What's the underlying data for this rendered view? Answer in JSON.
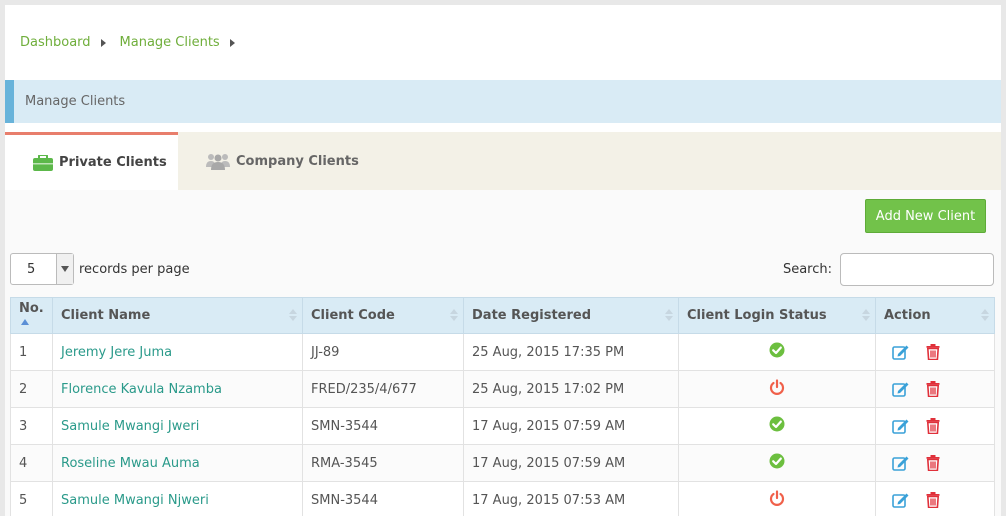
{
  "breadcrumb": {
    "items": [
      "Dashboard",
      "Manage Clients"
    ]
  },
  "section": {
    "title": "Manage Clients"
  },
  "tabs": {
    "private": "Private Clients",
    "company": "Company Clients"
  },
  "actions": {
    "add_client": "Add New Client"
  },
  "table_controls": {
    "page_size": "5",
    "records_label": "records per page",
    "search_label": "Search:",
    "search_value": ""
  },
  "columns": {
    "no": "No.",
    "name": "Client Name",
    "code": "Client Code",
    "date": "Date Registered",
    "status": "Client Login Status",
    "action": "Action"
  },
  "status_colors": {
    "active": "#6cbf3f",
    "inactive": "#f0604a"
  },
  "rows": [
    {
      "no": "1",
      "name": "Jeremy Jere Juma",
      "code": "JJ-89",
      "date": "25 Aug, 2015 17:35 PM",
      "status": "active"
    },
    {
      "no": "2",
      "name": "Florence Kavula Nzamba",
      "code": "FRED/235/4/677",
      "date": "25 Aug, 2015 17:02 PM",
      "status": "inactive"
    },
    {
      "no": "3",
      "name": "Samule Mwangi Jweri",
      "code": "SMN-3544",
      "date": "17 Aug, 2015 07:59 AM",
      "status": "active"
    },
    {
      "no": "4",
      "name": "Roseline Mwau Auma",
      "code": "RMA-3545",
      "date": "17 Aug, 2015 07:59 AM",
      "status": "active"
    },
    {
      "no": "5",
      "name": "Samule Mwangi Njweri",
      "code": "SMN-3544",
      "date": "17 Aug, 2015 07:53 AM",
      "status": "inactive"
    }
  ]
}
